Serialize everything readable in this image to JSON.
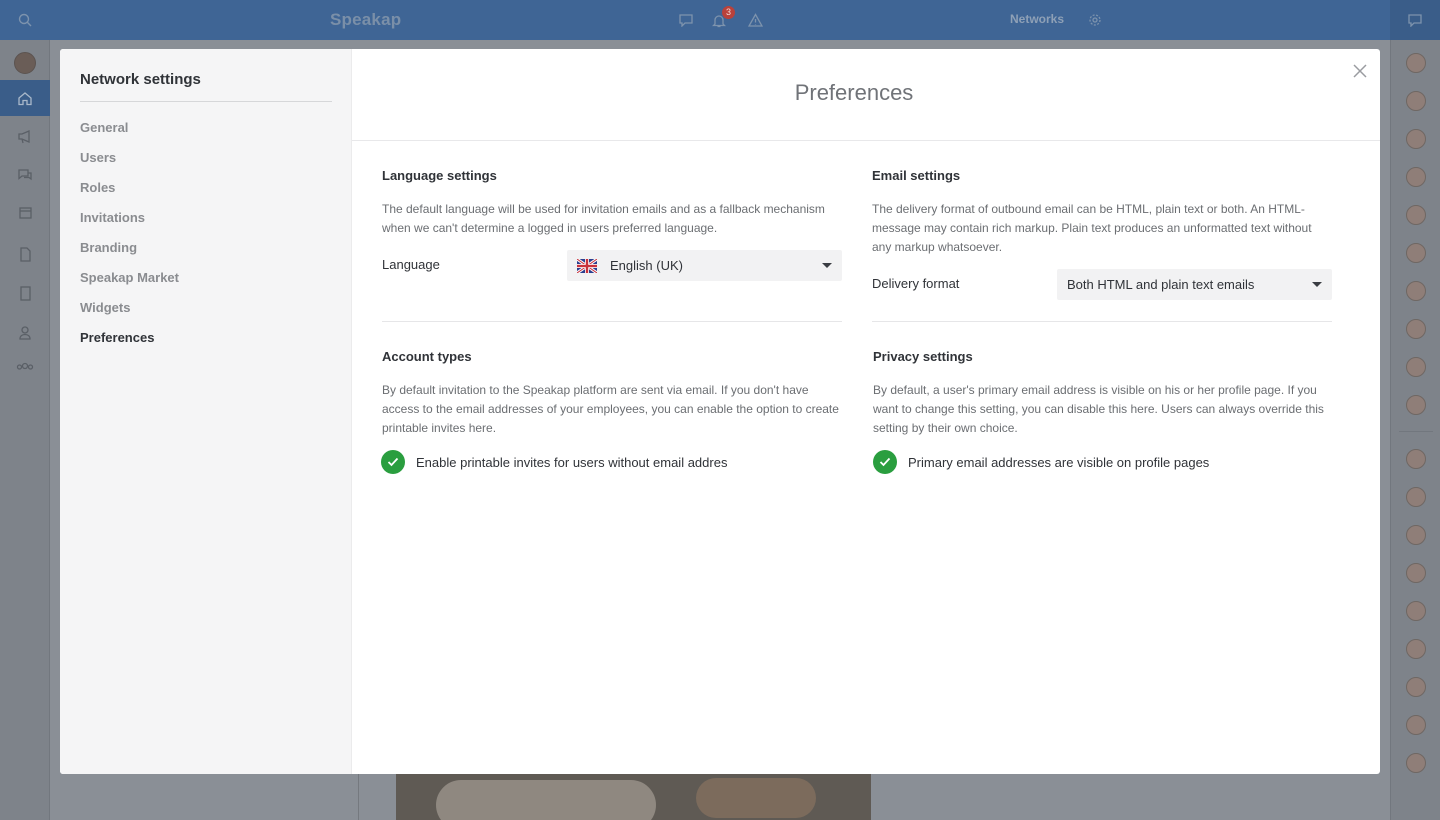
{
  "app": {
    "brand": "Speakap",
    "notification_count": "3",
    "networks_label": "Networks"
  },
  "modal": {
    "sidebar": {
      "title": "Network settings",
      "items": [
        {
          "label": "General"
        },
        {
          "label": "Users"
        },
        {
          "label": "Roles"
        },
        {
          "label": "Invitations"
        },
        {
          "label": "Branding"
        },
        {
          "label": "Speakap Market"
        },
        {
          "label": "Widgets"
        },
        {
          "label": "Preferences",
          "active": true
        }
      ]
    },
    "title": "Preferences",
    "language": {
      "title": "Language settings",
      "description": "The default language will be used for invitation emails and as a fallback mechanism when we can't determine a logged in users preferred language.",
      "field_label": "Language",
      "selected": "English (UK)"
    },
    "email": {
      "title": "Email settings",
      "description": "The delivery format of outbound email can be HTML, plain text or both. An HTML-message may contain rich markup. Plain text produces an unformatted text without any markup whatsoever.",
      "field_label": "Delivery format",
      "selected": "Both HTML and plain text emails"
    },
    "account": {
      "title": "Account types",
      "description": "By default invitation to the Speakap platform are sent via email. If you don't have access to the email addresses of your employees, you can enable the option to create printable invites here.",
      "checkbox_label": "Enable printable invites for users without email addres",
      "checked": true
    },
    "privacy": {
      "title": "Privacy settings",
      "description": "By default, a user's primary email address is visible on his or her profile page. If you want to change this setting, you can disable this here. Users can always override this setting by their own choice.",
      "checkbox_label": "Primary email addresses are visible on profile pages",
      "checked": true
    }
  },
  "colors": {
    "topbar": "#3f6595",
    "check": "#2a9e3f",
    "overlay": "#8a8f96"
  }
}
